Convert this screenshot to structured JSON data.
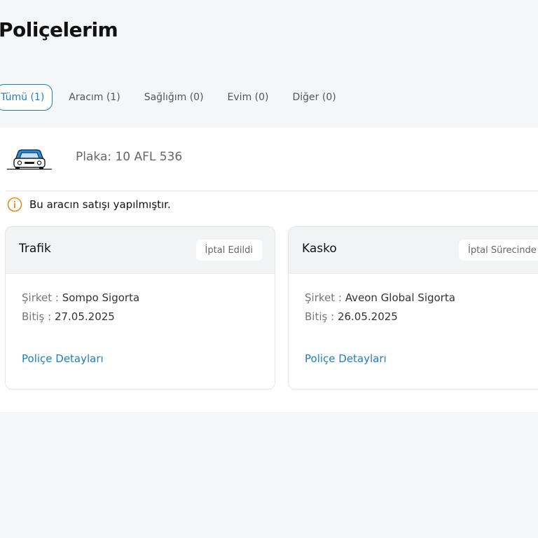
{
  "page": {
    "title": "Poliçelerim"
  },
  "tabs": [
    {
      "label": "Tümü (1)",
      "active": true
    },
    {
      "label": "Aracım (1)"
    },
    {
      "label": "Sağlığım (0)"
    },
    {
      "label": "Evim (0)"
    },
    {
      "label": "Diğer (0)"
    }
  ],
  "vehicle": {
    "plate": "Plaka: 10 AFL 536",
    "icon": "car-icon"
  },
  "notice": {
    "icon": "info-circle-icon",
    "text": "Bu aracın satışı yapılmıştır.",
    "color": "#e08a1e"
  },
  "policies": [
    {
      "title": "Trafik",
      "status": "İptal Edildi",
      "company_label": "Şirket :",
      "company": "Sompo Sigorta",
      "end_label": "Bitiş :",
      "end_date": "27.05.2025",
      "link": "Poliçe Detayları"
    },
    {
      "title": "Kasko",
      "status": "İptal Sürecinde",
      "company_label": "Şirket :",
      "company": "Aveon Global Sigorta",
      "end_label": "Bitiş :",
      "end_date": "26.05.2025",
      "link": "Poliçe Detayları"
    }
  ],
  "colors": {
    "accent": "#1d7ec4",
    "car_blue": "#1f8ee6",
    "warning": "#e08a1e"
  }
}
